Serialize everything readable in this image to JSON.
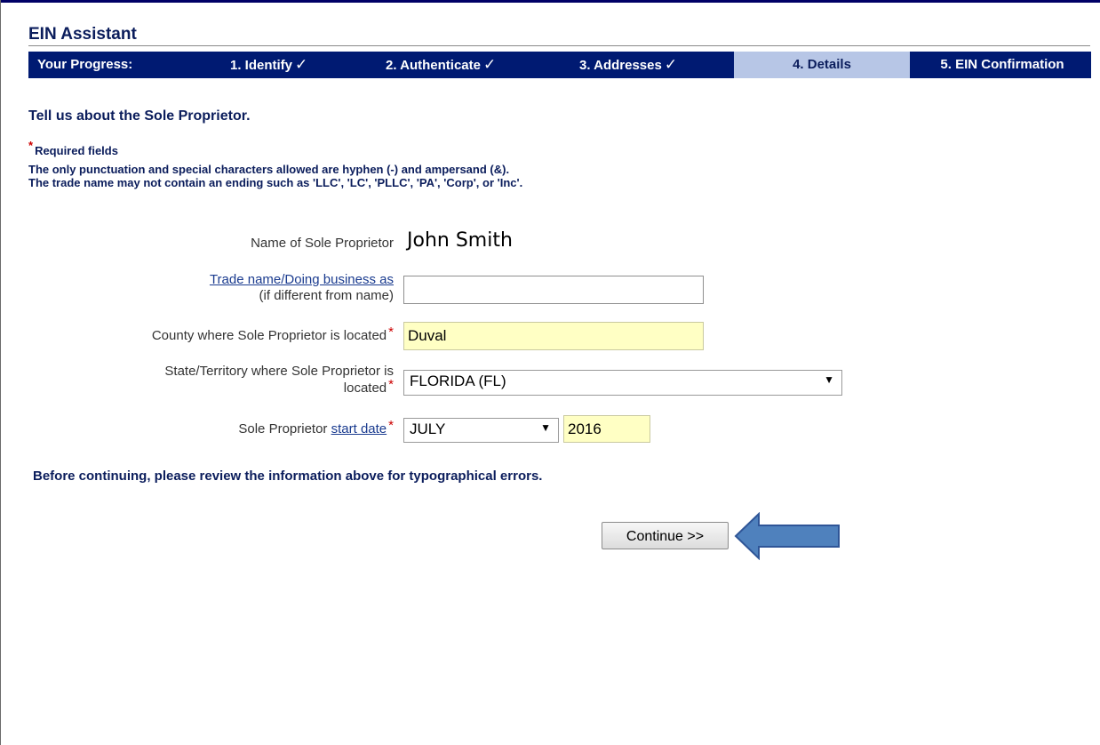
{
  "header": {
    "title": "EIN Assistant"
  },
  "progress": {
    "label": "Your Progress:",
    "steps": [
      {
        "label": "1. Identify",
        "status": "done",
        "mark": "✓"
      },
      {
        "label": "2. Authenticate",
        "status": "done",
        "mark": "✓"
      },
      {
        "label": "3. Addresses",
        "status": "done",
        "mark": "✓"
      },
      {
        "label": "4. Details",
        "status": "current",
        "mark": ""
      },
      {
        "label": "5. EIN Confirmation",
        "status": "pending",
        "mark": ""
      }
    ]
  },
  "form": {
    "heading": "Tell us about the Sole Proprietor.",
    "required_mark": "*",
    "required_label": "Required fields",
    "notes": [
      "The only punctuation and special characters allowed are hyphen (-) and ampersand (&).",
      "The trade name may not contain an ending such as 'LLC', 'LC', 'PLLC', 'PA', 'Corp', or 'Inc'."
    ],
    "name": {
      "label": "Name of Sole Proprietor",
      "value": "John Smith"
    },
    "trade_name": {
      "link_label": "Trade name/Doing business as",
      "sub_label": "(if different from name)",
      "value": ""
    },
    "county": {
      "label": "County where Sole Proprietor is located",
      "value": "Duval"
    },
    "state": {
      "label_line1": "State/Territory where Sole Proprietor is",
      "label_line2": "located",
      "value": "FLORIDA (FL)"
    },
    "start_date": {
      "label_prefix": "Sole Proprietor",
      "link_label": "start date",
      "month": "JULY",
      "year": "2016"
    },
    "review_text": "Before continuing, please review the information above for typographical errors.",
    "continue_label": "Continue >>"
  },
  "colors": {
    "nav_bg": "#001a72",
    "current_step_bg": "#b7c6e6",
    "filled_field_bg": "#ffffc4",
    "annotation_arrow": "#4f81bd"
  }
}
